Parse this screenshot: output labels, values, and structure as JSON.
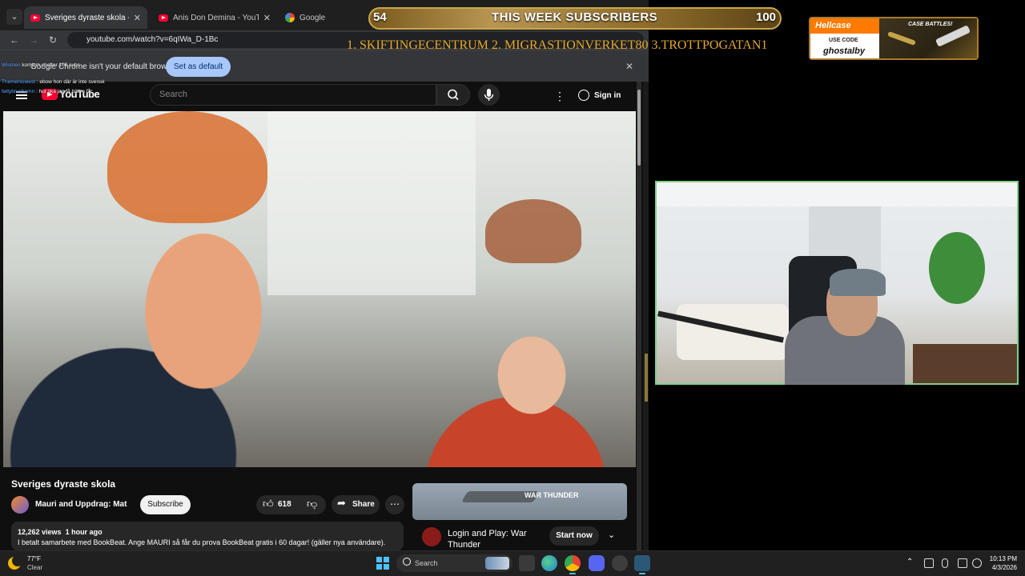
{
  "browser": {
    "tab_menu_label": "⌄",
    "tabs": [
      {
        "title": "Sveriges dyraste skola - YouTube",
        "close": "✕",
        "active": true
      },
      {
        "title": "Anis Don Demina - YouTube",
        "close": "✕",
        "active": false
      },
      {
        "title": "Google",
        "close": "",
        "active": false
      }
    ],
    "nav": {
      "back": "←",
      "forward": "→",
      "reload": "↻"
    },
    "url": "youtube.com/watch?v=6qIWa_D-1Bc",
    "infobar": {
      "message": "Google Chrome isn't your default browser",
      "button": "Set as default",
      "close": "✕"
    }
  },
  "chat": [
    {
      "user": "Wismen",
      "text": "komjem chatter 10€ subs"
    },
    {
      "user": "Themeniswest",
      "text": ": ebow hon där är inte svensk"
    },
    {
      "user": "fattybrushamn",
      "text": ": hur ska jag få bättre får"
    }
  ],
  "youtube": {
    "logo_text": "YouTube",
    "search_placeholder": "Search",
    "more": "⋮",
    "signin": "Sign in",
    "video": {
      "title": "Sveriges dyraste skola",
      "channel": "Mauri and Uppdrag: Mat",
      "subscribe": "Subscribe",
      "likes": "618",
      "share": "Share",
      "more": "⋯",
      "views": "12,262 views",
      "age": "1 hour ago",
      "description": "I betalt samarbete med BookBeat. Ange MAURI så får du prova BookBeat gratis i 60 dagar! (gäller nya användare)."
    },
    "ad": {
      "logo": "WAR THUNDER",
      "title": "Login and Play: War Thunder",
      "button": "Start now",
      "chevron": "⌄"
    }
  },
  "stream": {
    "subs_current": "54",
    "subs_title": "THIS WEEK SUBSCRIBERS",
    "subs_goal": "100",
    "top_subs": "1. SKIFTINGECENTRUM  2. MIGRASTIONVERKET80  3.TROTTPOGATAN1",
    "sponsor": {
      "brand": "Hellcase",
      "use_code": "USE CODE",
      "code": "ghostalby",
      "battles": "CASE BATTLES!"
    }
  },
  "taskbar": {
    "weather_temp": "77°F",
    "weather_desc": "Clear",
    "search": "Search",
    "tray_chevron": "⌃",
    "time": "10:13 PM",
    "date": "4/3/2026"
  }
}
